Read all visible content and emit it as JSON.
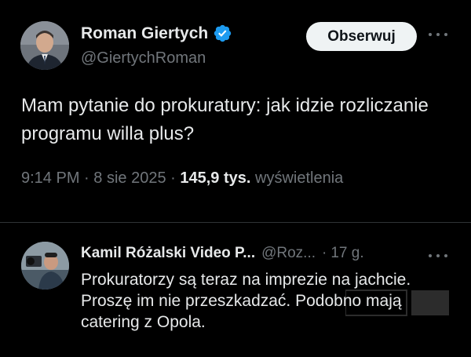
{
  "tweet": {
    "author_name": "Roman Giertych",
    "author_handle": "@GiertychRoman",
    "verified": true,
    "follow_label": "Obserwuj",
    "text": "Mam pytanie do prokuratury: jak idzie rozliczanie programu willa plus?",
    "time": "9:14 PM",
    "date": "8 sie 2025",
    "views_count": "145,9 tys.",
    "views_label": "wyświetlenia",
    "separator": "·"
  },
  "reply": {
    "author_name": "Kamil Różalski Video P...",
    "author_handle": "@Roz...",
    "separator": "·",
    "time": "17 g.",
    "text": "Prokuratorzy są teraz na imprezie na jachcie. Proszę im nie przeszkadzać. Podobno mają catering z Opola."
  },
  "colors": {
    "background": "#000000",
    "text": "#e7e9ea",
    "secondary": "#71767b",
    "verified_badge": "#1d9bf0",
    "button_bg": "#eff3f4",
    "divider": "#2f3336"
  },
  "icons": [
    "verified-badge-icon",
    "more-options-icon"
  ]
}
